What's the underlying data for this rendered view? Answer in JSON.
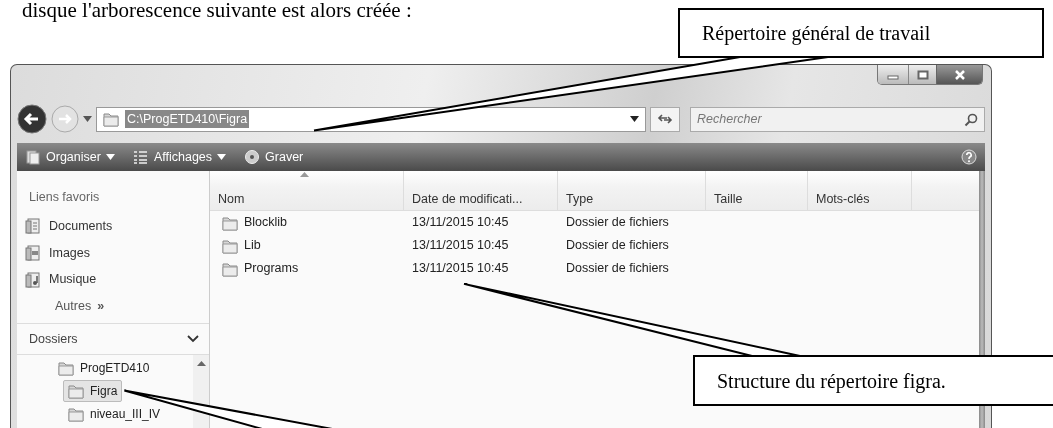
{
  "doc_text": "disque l'arborescence suivante est alors créée :",
  "window": {
    "address": "C:\\ProgETD410\\Figra",
    "search": {
      "placeholder": "Rechercher"
    },
    "toolbar": [
      {
        "label": "Organiser",
        "kind": "menu"
      },
      {
        "label": "Affichages",
        "kind": "menu"
      },
      {
        "label": "Graver",
        "kind": "action"
      }
    ]
  },
  "sidebar": {
    "favorites_title": "Liens favoris",
    "links": [
      {
        "label": "Documents",
        "kind": "documents"
      },
      {
        "label": "Images",
        "kind": "images"
      },
      {
        "label": "Musique",
        "kind": "music"
      }
    ],
    "more": {
      "label": "Autres",
      "glyph": "»"
    },
    "folders_title": "Dossiers",
    "tree": [
      {
        "label": "ProgETD410",
        "selected": false,
        "children": [
          {
            "label": "Figra",
            "selected": true
          },
          {
            "label": "niveau_III_IV",
            "selected": false
          }
        ]
      }
    ]
  },
  "table": {
    "columns": [
      "Nom",
      "Date de modificati...",
      "Type",
      "Taille",
      "Mots-clés"
    ],
    "rows": [
      [
        "Blocklib",
        "13/11/2015 10:45",
        "Dossier de fichiers"
      ],
      [
        "Lib",
        "13/11/2015 10:45",
        "Dossier de fichiers"
      ],
      [
        "Programs",
        "13/11/2015 10:45",
        "Dossier de fichiers"
      ]
    ]
  },
  "callouts": [
    {
      "text": "Répertoire général de travail"
    },
    {
      "text": "Structure du répertoire figra."
    }
  ]
}
